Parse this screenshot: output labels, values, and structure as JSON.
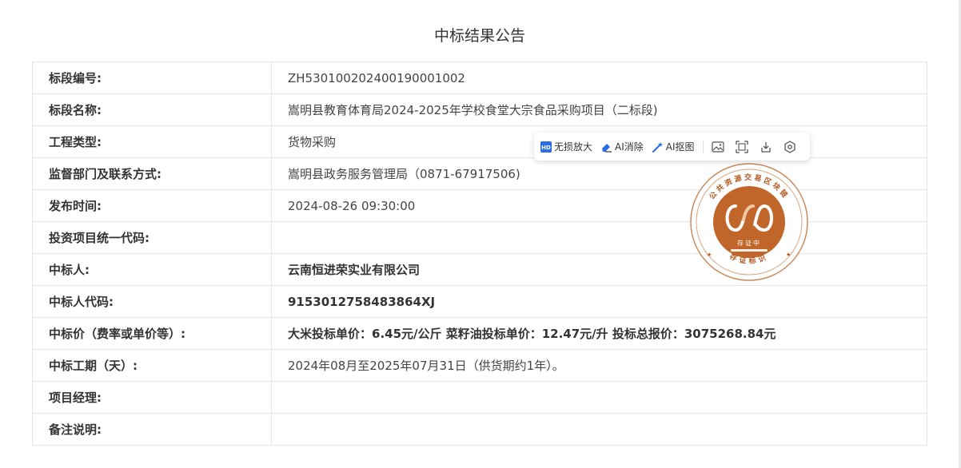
{
  "page": {
    "title": "中标结果公告"
  },
  "rows": [
    {
      "label": "标段编号:",
      "value": "ZH5301002024001900010​02"
    },
    {
      "label": "标段名称:",
      "value": "嵩明县教育体育局2024-2025年学校食堂大宗食品采购项目（二标段)"
    },
    {
      "label": "工程类型:",
      "value": "货物采购"
    },
    {
      "label": "监督部门及联系方式:",
      "value": "嵩明县政务服务管理局（0871-67917506)"
    },
    {
      "label": "发布时间:",
      "value": "2024-08-26 09:30:00"
    },
    {
      "label": "投资项目统一代码:",
      "value": ""
    },
    {
      "label": "中标人:",
      "value": "云南恒进荣实业有限公司"
    },
    {
      "label": "中标人代码:",
      "value": "9153012758483864XJ"
    },
    {
      "label": "中标价（费率或单价等）:",
      "value": "大米投标单价：6.45元/公斤 菜籽油投标单价：12.47元/升 投标总报价：3075268.84元"
    },
    {
      "label": "中标工期（天）:",
      "value": "2024年08月至2025年07月31日（供货期约1年）。"
    },
    {
      "label": "项目经理:",
      "value": ""
    },
    {
      "label": "备注说明:",
      "value": ""
    }
  ],
  "toolbar": {
    "lossless_zoom": "无损放大",
    "ai_erase": "AI消除",
    "ai_cutout": "AI抠图",
    "icons": [
      "image-edit-icon",
      "crop-icon",
      "download-icon",
      "settings-icon"
    ]
  },
  "seal": {
    "ring_text": "公共资源交易区块链",
    "center_text": "存证中",
    "bottom_text": "存证标识",
    "color": "#c0662a"
  }
}
